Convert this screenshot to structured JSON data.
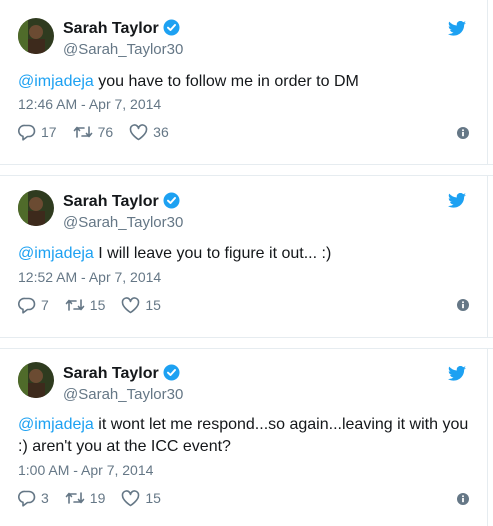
{
  "tweets": [
    {
      "name": "Sarah Taylor",
      "handle": "@Sarah_Taylor30",
      "mention": "@imjadeja",
      "text": " you have to follow me in order to DM",
      "time": "12:46 AM - Apr 7, 2014",
      "replies": "17",
      "retweets": "76",
      "likes": "36"
    },
    {
      "name": "Sarah Taylor",
      "handle": "@Sarah_Taylor30",
      "mention": "@imjadeja",
      "text": " I will leave you to figure it out... :)",
      "time": "12:52 AM - Apr 7, 2014",
      "replies": "7",
      "retweets": "15",
      "likes": "15"
    },
    {
      "name": "Sarah Taylor",
      "handle": "@Sarah_Taylor30",
      "mention": "@imjadeja",
      "text": " it wont let me respond...so again...leaving it with you :) aren't you at the ICC event?",
      "time": "1:00 AM - Apr 7, 2014",
      "replies": "3",
      "retweets": "19",
      "likes": "15"
    }
  ],
  "icons": {
    "verified": "verified-badge-icon",
    "brand": "twitter-bird-icon",
    "reply": "reply-icon",
    "retweet": "retweet-icon",
    "like": "heart-icon",
    "info": "info-icon"
  },
  "colors": {
    "brand": "#1da1f2",
    "text": "#14171a",
    "muted": "#657786",
    "border": "#e6ecf0"
  }
}
